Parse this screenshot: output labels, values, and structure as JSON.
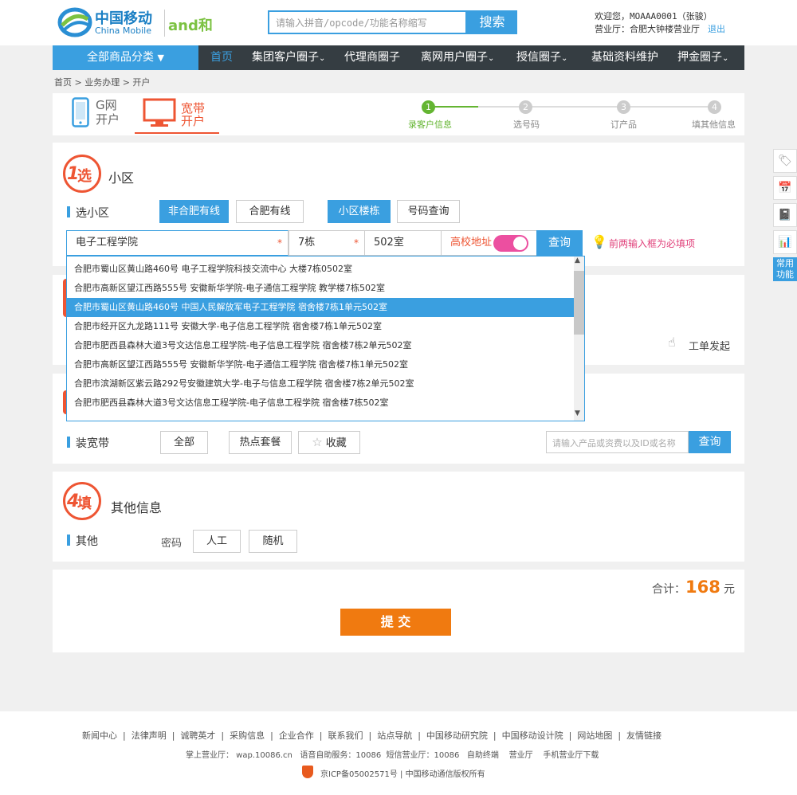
{
  "header": {
    "logo_cn": "中国移动",
    "logo_en": "China Mobile",
    "logo_and": "and和",
    "search_placeholder": "请输入拼音/opcode/功能名称缩写",
    "search_btn": "搜索",
    "welcome": "欢迎您，MOAAA0001（张骏）",
    "hall": "营业厅：合肥大钟楼营业厅",
    "logout": "退出"
  },
  "nav": {
    "all": "全部商品分类",
    "items": [
      "首页",
      "集团客户圈子",
      "代理商圈子",
      "离网用户圈子",
      "授信圈子",
      "基础资料维护",
      "押金圈子"
    ]
  },
  "breadcrumb": "首页 > 业务办理 > 开户",
  "tabs": {
    "g_line1": "G网",
    "g_line2": "开户",
    "b_line1": "宽带",
    "b_line2": "开户"
  },
  "steps": [
    {
      "num": "1",
      "label": "录客户信息"
    },
    {
      "num": "2",
      "label": "选号码"
    },
    {
      "num": "3",
      "label": "订产品"
    },
    {
      "num": "4",
      "label": "填其他信息"
    }
  ],
  "sec1": {
    "badge_num": "1",
    "badge_txt": "选",
    "title": "小区",
    "field_label": "选小区",
    "btn_non_hefei": "非合肥有线",
    "btn_hefei": "合肥有线",
    "btn_building": "小区楼栋",
    "btn_num_query": "号码查询",
    "input_school": "电子工程学院",
    "input_building": "7栋",
    "input_room": "502室",
    "campus_label": "高校地址",
    "query_btn": "查询",
    "tip": "前两输入框为必填项",
    "req_mark": "*"
  },
  "dropdown": [
    "合肥市蜀山区黄山路460号 电子工程学院科技交流中心 大楼7栋0502室",
    "合肥市高新区望江西路555号 安徽新华学院-电子通信工程学院 教学楼7栋502室",
    "合肥市蜀山区黄山路460号 中国人民解放军电子工程学院 宿舍楼7栋1单元502室",
    "合肥市经开区九龙路111号 安徽大学-电子信息工程学院 宿舍楼7栋1单元502室",
    "合肥市肥西县森林大道3号文达信息工程学院-电子信息工程学院 宿舍楼7栋2单元502室",
    "合肥市高新区望江西路555号 安徽新华学院-电子通信工程学院 宿舍楼7栋1单元502室",
    "合肥市滨湖新区紫云路292号安徽建筑大学-电子与信息工程学院 宿舍楼7栋2单元502室",
    "合肥市肥西县森林大道3号文达信息工程学院-电子信息工程学院 宿舍楼7栋502室"
  ],
  "sec2": {
    "work_order": "工单发起"
  },
  "sec3": {
    "field_label": "装宽带",
    "btn_all": "全部",
    "btn_hot": "热点套餐",
    "btn_fav": "收藏",
    "search_placeholder": "请输入产品或资费以及ID或名称",
    "query_btn": "查询"
  },
  "sec4": {
    "badge_num": "4",
    "badge_txt": "填",
    "title": "其他信息",
    "field_label": "其他",
    "pwd_label": "密码",
    "btn_manual": "人工",
    "btn_random": "随机"
  },
  "total": {
    "label": "合计：",
    "amount": "168",
    "unit": "元"
  },
  "submit": "提 交",
  "right_bar": {
    "common": "常用功能"
  },
  "footer": {
    "links": [
      "新闻中心",
      "法律声明",
      "诚聘英才",
      "采购信息",
      "企业合作",
      "联系我们",
      "站点导航",
      "中国移动研究院",
      "中国移动设计院",
      "网站地图",
      "友情链接"
    ],
    "line2": "掌上营业厅： wap.10086.cn   语音自助服务：10086  短信营业厅：10086   自助终端    营业厅    手机营业厅下载",
    "icp": "京ICP备05002571号 | 中国移动通信版权所有"
  },
  "colors": {
    "accent": "#3a9fe0",
    "orange": "#f07a10",
    "red": "#e53",
    "green": "#64b532",
    "nav_dark": "#353d42"
  }
}
